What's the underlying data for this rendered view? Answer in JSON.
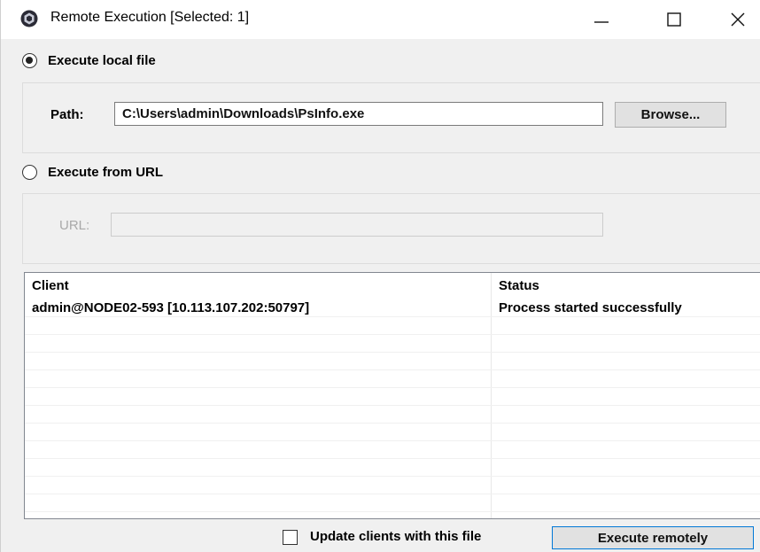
{
  "window": {
    "title": "Remote Execution [Selected: 1]",
    "icon": "app-icon"
  },
  "local_file": {
    "radio_label": "Execute local file",
    "checked": true,
    "path_label": "Path:",
    "path_value": "C:\\Users\\admin\\Downloads\\PsInfo.exe",
    "browse_label": "Browse..."
  },
  "url_source": {
    "radio_label": "Execute from URL",
    "checked": false,
    "url_label": "URL:",
    "url_value": ""
  },
  "client_list": {
    "columns": [
      "Client",
      "Status"
    ],
    "rows": [
      [
        "admin@NODE02-593 [10.113.107.202:50797]",
        "Process started successfully"
      ]
    ]
  },
  "footer": {
    "update_clients_label": "Update clients with this file",
    "update_clients_checked": false,
    "execute_label": "Execute remotely"
  }
}
